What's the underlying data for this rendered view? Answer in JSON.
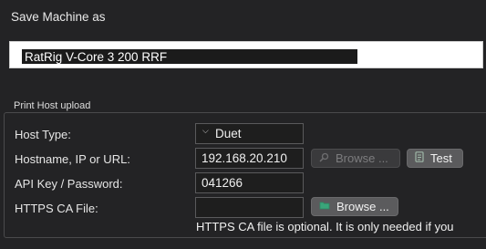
{
  "dialog": {
    "title": "Save Machine as"
  },
  "machine_name": {
    "value": "RatRig V-Core 3 200 RRF"
  },
  "print_host": {
    "group_label": "Print Host upload",
    "host_type": {
      "label": "Host Type:",
      "value": "Duet"
    },
    "hostname": {
      "label": "Hostname, IP or URL:",
      "value": "192.168.20.210"
    },
    "api_key": {
      "label": "API Key / Password:",
      "value": "041266"
    },
    "https_ca": {
      "label": "HTTPS CA File:",
      "value": ""
    },
    "buttons": {
      "browse_disabled": "Browse ...",
      "test": "Test",
      "browse": "Browse ..."
    },
    "note": "HTTPS CA file is optional. It is only needed if you"
  },
  "icons": {
    "browse_disabled": "magnifier-icon",
    "test": "document-icon",
    "browse": "folder-icon"
  },
  "colors": {
    "background": "#232325",
    "field_background": "#1e1e1e",
    "button": "#5b5b5d",
    "button_disabled": "#3a3a3c"
  }
}
